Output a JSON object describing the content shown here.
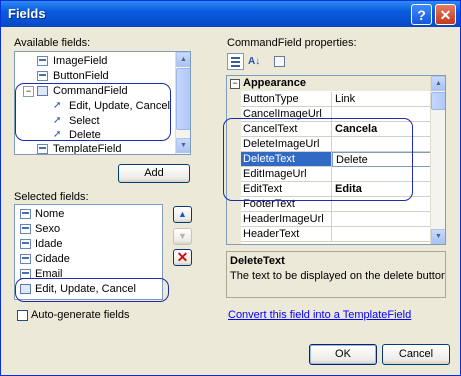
{
  "window": {
    "title": "Fields",
    "help_glyph": "?",
    "close_glyph": "✕"
  },
  "available": {
    "label": "Available fields:",
    "items": [
      {
        "label": "ImageField",
        "icon": "image-field-icon"
      },
      {
        "label": "ButtonField",
        "icon": "button-field-icon"
      },
      {
        "label": "CommandField",
        "icon": "command-field-icon",
        "toggle": "−"
      },
      {
        "label": "Edit, Update, Cancel",
        "icon": "command-item-icon"
      },
      {
        "label": "Select",
        "icon": "command-item-icon"
      },
      {
        "label": "Delete",
        "icon": "command-item-icon"
      },
      {
        "label": "TemplateField",
        "icon": "template-field-icon"
      }
    ],
    "add_label": "Add"
  },
  "selected": {
    "label": "Selected fields:",
    "items": [
      "Nome",
      "Sexo",
      "Idade",
      "Cidade",
      "Email",
      "Edit, Update, Cancel"
    ]
  },
  "autogen_label": "Auto-generate fields",
  "properties": {
    "label": "CommandField properties:",
    "category": "Appearance",
    "category_toggle": "−",
    "rows": [
      {
        "name": "ButtonType",
        "value": "Link"
      },
      {
        "name": "CancelImageUrl",
        "value": ""
      },
      {
        "name": "CancelText",
        "value": "Cancela"
      },
      {
        "name": "DeleteImageUrl",
        "value": ""
      },
      {
        "name": "DeleteText",
        "value": "Delete"
      },
      {
        "name": "EditImageUrl",
        "value": ""
      },
      {
        "name": "EditText",
        "value": "Edita"
      },
      {
        "name": "FooterText",
        "value": ""
      },
      {
        "name": "HeaderImageUrl",
        "value": ""
      },
      {
        "name": "HeaderText",
        "value": ""
      }
    ],
    "help_title": "DeleteText",
    "help_desc": "The text to be displayed on the delete button."
  },
  "convert_link": "Convert this field into a TemplateField",
  "ok_label": "OK",
  "cancel_label": "Cancel",
  "colors": {
    "accent": "#0a246a",
    "highlight_ring": "#1b2db0",
    "link": "#0000ff",
    "delete_red": "#d01010"
  }
}
